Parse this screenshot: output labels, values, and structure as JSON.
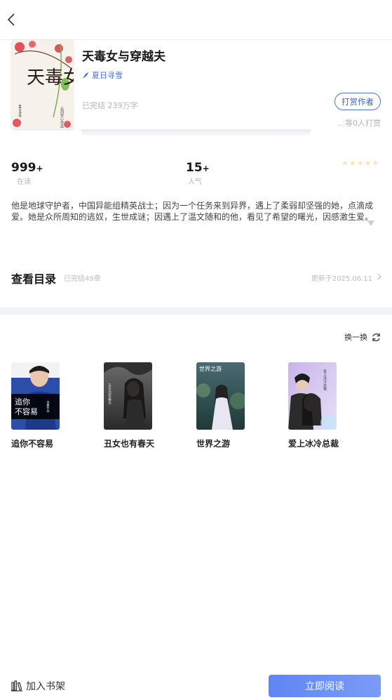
{
  "book": {
    "title": "天毒女与穿越夫",
    "author": "夏日寻雪",
    "meta": "已完结 239万字",
    "tip_button": "打赏作者",
    "tip_count": "...等0人打赏",
    "cover_text": {
      "big": "天毒女",
      "side": "云间赏心作品",
      "small": "夏日寻雪"
    }
  },
  "stats": {
    "readers": {
      "value": "999",
      "plus": "+",
      "label": "在读"
    },
    "popularity": {
      "value": "15",
      "plus": "+",
      "label": "人气"
    },
    "rating_stars": 5
  },
  "synopsis": "他是地球守护者，中国异能组精英战士；因为一个任务来到异界，遇上了柔弱却坚强的她，点滴成爱。她是众所周知的逃奴，生世成谜；因遇上了温文随和的他，看见了希望的曙光，因感激生爱。",
  "catalog": {
    "title": "查看目录",
    "count": "已完结49章",
    "updated": "更新于2025.06.11"
  },
  "recommend": {
    "refresh_label": "换一换",
    "items": [
      {
        "title": "追你不容易",
        "cover_text": "追你\n不容易",
        "cover_sub": "苏菱作品",
        "color": "#2b4fa8"
      },
      {
        "title": "丑女也有春天",
        "cover_text": "丑女也有春天",
        "color": "#3c3c3c"
      },
      {
        "title": "世界之游",
        "cover_text": "世界之游",
        "color": "#2f4f4f"
      },
      {
        "title": "爱上冰冷总裁",
        "cover_text": "爱上冰冷总裁",
        "color": "#b9a6dd"
      }
    ]
  },
  "bottom": {
    "shelf_label": "加入书架",
    "read_label": "立即阅读"
  },
  "colors": {
    "accent": "#3f63c9",
    "read_button": "#6a8ff4",
    "star": "#fbe4b5"
  }
}
